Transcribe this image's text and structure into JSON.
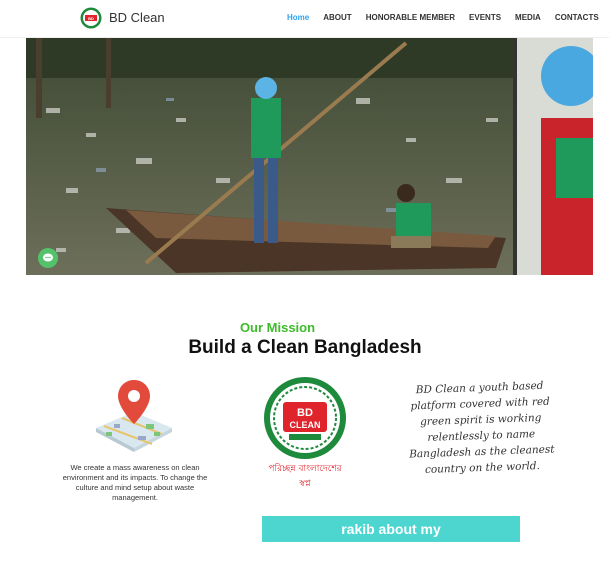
{
  "header": {
    "brand": "BD Clean",
    "nav": [
      {
        "label": "Home",
        "active": true
      },
      {
        "label": "ABOUT",
        "active": false
      },
      {
        "label": "HONORABLE MEMBER",
        "active": false
      },
      {
        "label": "EVENTS",
        "active": false
      },
      {
        "label": "MEDIA",
        "active": false
      },
      {
        "label": "CONTACTS",
        "active": false
      }
    ]
  },
  "mission": {
    "subtitle": "Our Mission",
    "title": "Build a Clean Bangladesh",
    "col1_text": "We create a mass awareness on clean environment and its impacts. To change the culture and mind setup about waste management.",
    "logo_text": "BD CLEAN",
    "logo_caption": "পরিচ্ছন্ন বাংলাদেশের স্বপ্ন",
    "col3_text": "BD Clean a youth based platform covered with red green spirit is working relentlessly to name Bangladesh as the cleanest country on the world."
  },
  "cta": {
    "label": "rakib about my"
  },
  "colors": {
    "accent": "#2ea3f2",
    "mission_green": "#3dbb2a",
    "cta": "#4dd6cf",
    "brand_red": "#e0242c",
    "brand_green": "#1e8a3c"
  },
  "icons": [
    "bd-clean-logo-icon",
    "map-pin-icon",
    "chat-icon"
  ]
}
